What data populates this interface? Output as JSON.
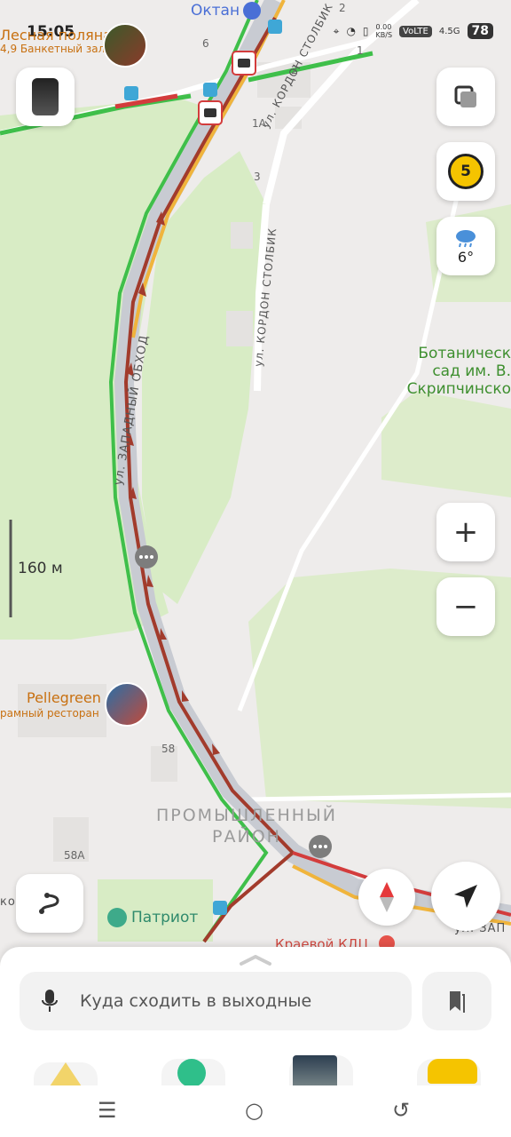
{
  "status_bar": {
    "time": "15:05",
    "net_speed": "0.00\nKB/S",
    "volte": "VoLTE",
    "signal": "4.5G",
    "battery": "78"
  },
  "map": {
    "poi_top": {
      "name": "Октан",
      "color": "#4a6fd6"
    },
    "poi_lesnaya": {
      "name": "Лесная поляна",
      "sub": "4,9 Банкетный зал"
    },
    "poi_pellegreen": {
      "name": "Pellegreen",
      "sub": "рамный ресторан"
    },
    "botanical": {
      "line1": "Ботаническ",
      "line2": "сад им. В.",
      "line3": "Скрипчинско"
    },
    "street_kordon_1": "ул. КОРДОН СТОЛБИК",
    "street_kordon_2": "ул. КОРДОН СТОЛБИК",
    "street_zapadny": "ул. ЗАПАДНЫЙ ОБХОД",
    "street_zap_right": "ул. ЗАП",
    "street_kor_left": "кор",
    "district_line1": "ПРОМЫШЛЕННЫЙ",
    "district_line2": "РАЙОН",
    "houses": [
      "2",
      "6",
      "2",
      "1",
      "1А",
      "3",
      "58",
      "58А"
    ],
    "poi_patriot": "Патриот",
    "poi_kraevoy": "Краевой КДЦ",
    "scale": "160 м",
    "traffic_score": "5",
    "weather_temp": "6°",
    "colors": {
      "jam": "#a23b2c",
      "slow": "#f0b43c",
      "free": "#3fbf4a",
      "park": "#d8ecc5"
    }
  },
  "controls": {
    "layers_icon": "layers-icon",
    "zoom_in": "+",
    "zoom_out": "−"
  },
  "bottom_sheet": {
    "search_placeholder": "Куда сходить в выходные"
  },
  "navbar": {
    "menu": "☰",
    "home": "○",
    "back": "↺"
  }
}
